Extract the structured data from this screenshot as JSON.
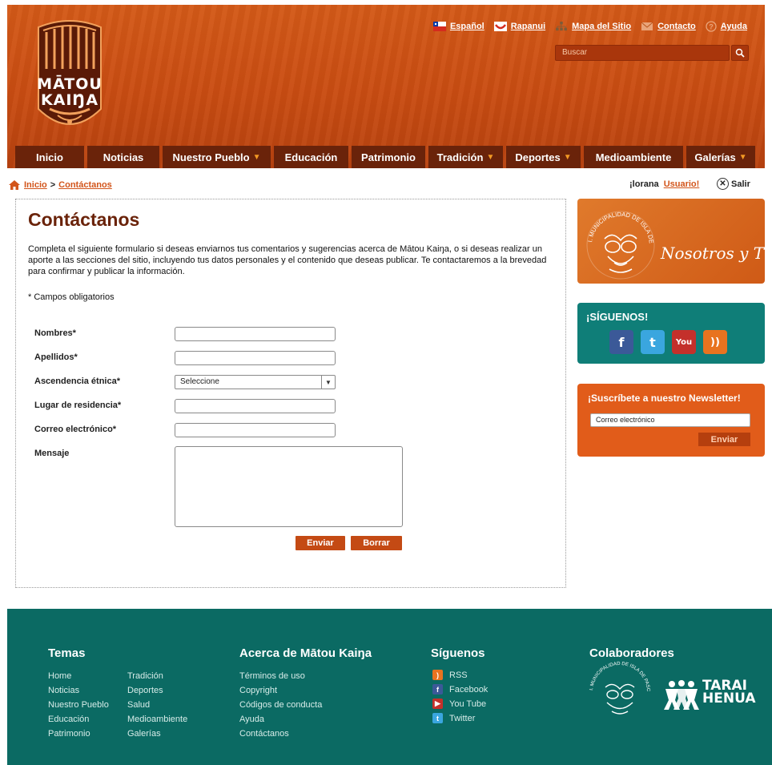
{
  "header": {
    "logo_line1": "MĀTOU",
    "logo_line2": "KAIŊA",
    "top_links": [
      {
        "label": "Español",
        "icon": "chile-flag-icon"
      },
      {
        "label": "Rapanui",
        "icon": "rapanui-flag-icon"
      },
      {
        "label": "Mapa del Sitio",
        "icon": "sitemap-icon"
      },
      {
        "label": "Contacto",
        "icon": "mail-icon"
      },
      {
        "label": "Ayuda",
        "icon": "help-icon"
      }
    ],
    "search_placeholder": "Buscar",
    "nav": [
      {
        "label": "Inicio",
        "caret": false
      },
      {
        "label": "Noticias",
        "caret": false
      },
      {
        "label": "Nuestro Pueblo",
        "caret": true
      },
      {
        "label": "Educación",
        "caret": false
      },
      {
        "label": "Patrimonio",
        "caret": false
      },
      {
        "label": "Tradición",
        "caret": true
      },
      {
        "label": "Deportes",
        "caret": true
      },
      {
        "label": "Medioambiente",
        "caret": false
      },
      {
        "label": "Galerías",
        "caret": true
      }
    ]
  },
  "breadcrumb": {
    "home": "Inicio",
    "separator": ">",
    "current": "Contáctanos"
  },
  "user": {
    "greeting": "¡lorana",
    "user_link": "Usuario!",
    "logout": "Salir"
  },
  "form": {
    "title": "Contáctanos",
    "intro": "Completa el siguiente formulario si deseas enviarnos tus comentarios y sugerencias acerca de Mātou Kaiŋa, o si deseas realizar un aporte a las secciones del sitio, incluyendo tus datos personales y el contenido que deseas publicar. Te contactaremos a la brevedad para confirmar y publicar la información.",
    "required_note": "* Campos obligatorios",
    "fields": {
      "nombres": "Nombres*",
      "apellidos": "Apellidos*",
      "ascendencia": "Ascendencia étnica*",
      "ascendencia_value": "Seleccione",
      "residencia": "Lugar de residencia*",
      "correo": "Correo electrónico*",
      "mensaje": "Mensaje"
    },
    "submit": "Enviar",
    "reset": "Borrar"
  },
  "sidebar": {
    "banner_seal": "I. MUNICIPALIDAD DE ISLA DE PASCUA",
    "banner_script": "Nosotros y Tú",
    "follow_title": "¡SÍGUENOS!",
    "social": [
      {
        "name": "facebook",
        "glyph": "f",
        "color": "#3b5998"
      },
      {
        "name": "twitter",
        "glyph": "t",
        "color": "#3aa6df"
      },
      {
        "name": "youtube",
        "glyph": "You",
        "color": "#c4302b"
      },
      {
        "name": "rss",
        "glyph": "))",
        "color": "#e8731f"
      }
    ],
    "newsletter_title": "¡Suscríbete a nuestro Newsletter!",
    "newsletter_placeholder": "Correo electrónico",
    "newsletter_button": "Enviar"
  },
  "footer": {
    "temas_title": "Temas",
    "temas_col1": [
      "Home",
      "Noticias",
      "Nuestro Pueblo",
      "Educación",
      "Patrimonio"
    ],
    "temas_col2": [
      "Tradición",
      "Deportes",
      "Salud",
      "Medioambiente",
      "Galerías"
    ],
    "acerca_title": "Acerca de Mātou Kaiŋa",
    "acerca_links": [
      "Términos de uso",
      "Copyright",
      "Códigos de conducta",
      "Ayuda",
      "Contáctanos"
    ],
    "siguenos_title": "Síguenos",
    "siguenos_links": [
      "RSS",
      "Facebook",
      "You Tube",
      "Twitter"
    ],
    "colab_title": "Colaboradores",
    "colab_seal": "I. MUNICIPALIDAD DE ISLA DE PASCUA",
    "colab_tarai_1": "TARAI",
    "colab_tarai_2": "HENUA"
  }
}
